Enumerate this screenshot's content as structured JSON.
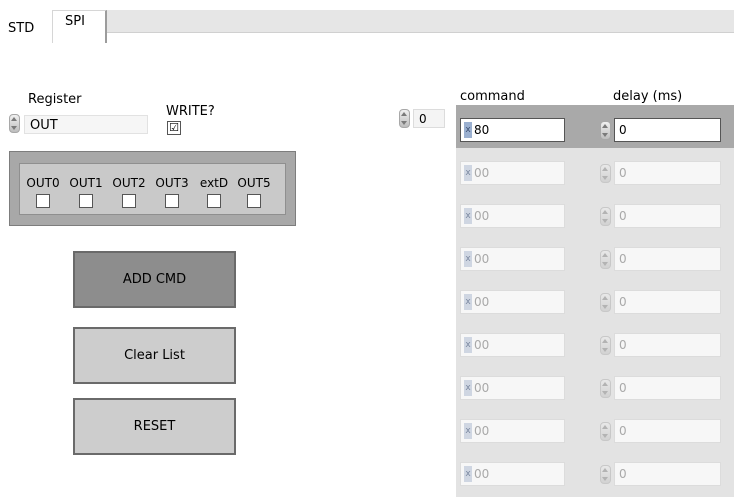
{
  "tabs": [
    {
      "label": "STD"
    },
    {
      "label": "SPI"
    }
  ],
  "register": {
    "label": "Register",
    "value": "OUT"
  },
  "write": {
    "label": "WRITE?",
    "checked": true,
    "check_glyph": "☑"
  },
  "out_bits": [
    {
      "label": "OUT0",
      "checked": false
    },
    {
      "label": "OUT1",
      "checked": false
    },
    {
      "label": "OUT2",
      "checked": false
    },
    {
      "label": "OUT3",
      "checked": false
    },
    {
      "label": "extD",
      "checked": false
    },
    {
      "label": "OUT5",
      "checked": false
    }
  ],
  "buttons": {
    "add_cmd": "ADD CMD",
    "clear_list": "Clear List",
    "reset": "RESET"
  },
  "index": {
    "value": "0"
  },
  "array": {
    "headers": {
      "command": "command",
      "delay": "delay (ms)"
    },
    "radix_glyph": "x",
    "rows": [
      {
        "command": "80",
        "delay": "0",
        "active": true
      },
      {
        "command": "00",
        "delay": "0",
        "active": false
      },
      {
        "command": "00",
        "delay": "0",
        "active": false
      },
      {
        "command": "00",
        "delay": "0",
        "active": false
      },
      {
        "command": "00",
        "delay": "0",
        "active": false
      },
      {
        "command": "00",
        "delay": "0",
        "active": false
      },
      {
        "command": "00",
        "delay": "0",
        "active": false
      },
      {
        "command": "00",
        "delay": "0",
        "active": false
      },
      {
        "command": "00",
        "delay": "0",
        "active": false
      }
    ]
  }
}
